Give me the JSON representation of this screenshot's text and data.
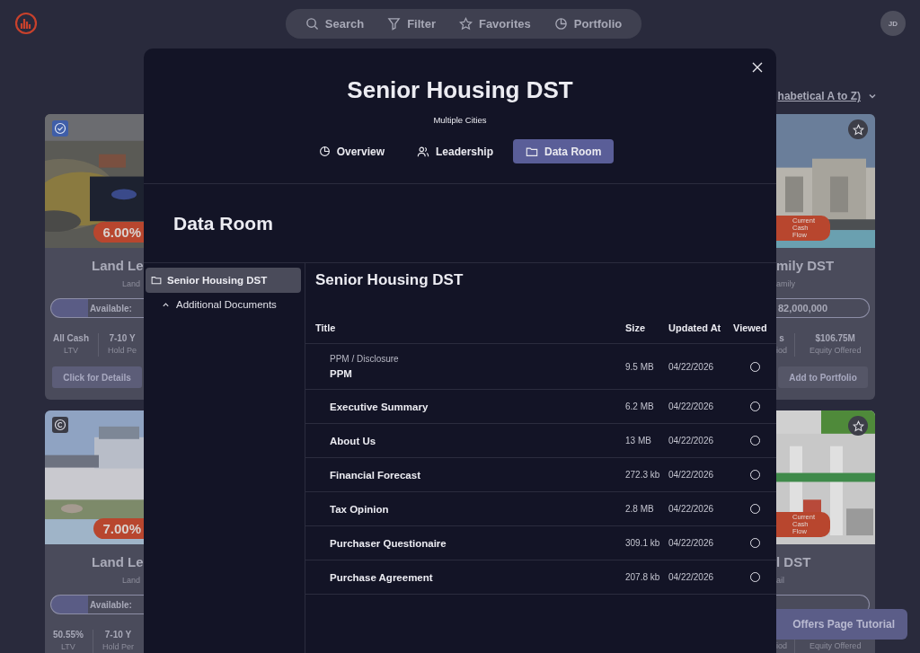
{
  "nav": {
    "items": [
      {
        "label": "Search"
      },
      {
        "label": "Filter"
      },
      {
        "label": "Favorites"
      },
      {
        "label": "Portfolio"
      }
    ],
    "avatar": "JD"
  },
  "sort": {
    "label": "habetical A to Z)"
  },
  "cards_left": [
    {
      "rate": "6.00%",
      "title": "Land Le",
      "subtitle": "Land",
      "availability": "Available:",
      "stats": [
        {
          "value": "All Cash",
          "label": "LTV"
        },
        {
          "value": "7-10 Y",
          "label": "Hold Pe"
        }
      ],
      "button": "Click for Details"
    },
    {
      "rate": "7.00%",
      "title": "Land Le",
      "subtitle": "Land",
      "availability": "Available:",
      "stats": [
        {
          "value": "50.55%",
          "label": "LTV"
        },
        {
          "value": "7-10 Y",
          "label": "Hold Per"
        }
      ]
    }
  ],
  "cards_right": [
    {
      "favorite": false,
      "tag": "Current Cash Flow",
      "title": "mily DST",
      "subtitle": "amily",
      "pill": "82,000,000",
      "stats": [
        {
          "value": "s",
          "label": "iod"
        },
        {
          "value": "$106.75M",
          "label": "Equity Offered"
        }
      ],
      "button": "Add to Portfolio"
    },
    {
      "favorite": false,
      "tag": "Current Cash Flow",
      "title": "l DST",
      "subtitle": "ail",
      "stats": [
        {
          "label": "iod"
        },
        {
          "label": "Equity Offered"
        }
      ]
    }
  ],
  "modal": {
    "title": "Senior Housing DST",
    "subtitle": "Multiple Cities",
    "tabs": [
      {
        "label": "Overview",
        "selected": false
      },
      {
        "label": "Leadership",
        "selected": false
      },
      {
        "label": "Data Room",
        "selected": true
      }
    ],
    "heading": "Data Room",
    "tree": [
      {
        "label": "Senior Housing DST",
        "selected": true,
        "children": [
          {
            "label": "Additional Documents",
            "expanded": true,
            "selected": false
          }
        ]
      }
    ],
    "folder_title": "Senior Housing DST",
    "columns": [
      "Title",
      "Size",
      "Updated At",
      "Viewed"
    ],
    "rows": [
      {
        "category": "PPM / Disclosure",
        "title": "PPM",
        "size": "9.5 MB",
        "updated": "04/22/2026",
        "viewed": false
      },
      {
        "title": "Executive Summary",
        "size": "6.2 MB",
        "updated": "04/22/2026",
        "viewed": false
      },
      {
        "title": "About Us",
        "size": "13 MB",
        "updated": "04/22/2026",
        "viewed": false
      },
      {
        "title": "Financial Forecast",
        "size": "272.3 kb",
        "updated": "04/22/2026",
        "viewed": false
      },
      {
        "title": "Tax Opinion",
        "size": "2.8 MB",
        "updated": "04/22/2026",
        "viewed": false
      },
      {
        "title": "Purchaser Questionaire",
        "size": "309.1 kb",
        "updated": "04/22/2026",
        "viewed": false
      },
      {
        "title": "Purchase Agreement",
        "size": "207.8 kb",
        "updated": "04/22/2026",
        "viewed": false
      }
    ]
  },
  "tutorial_button": "Offers Page Tutorial"
}
